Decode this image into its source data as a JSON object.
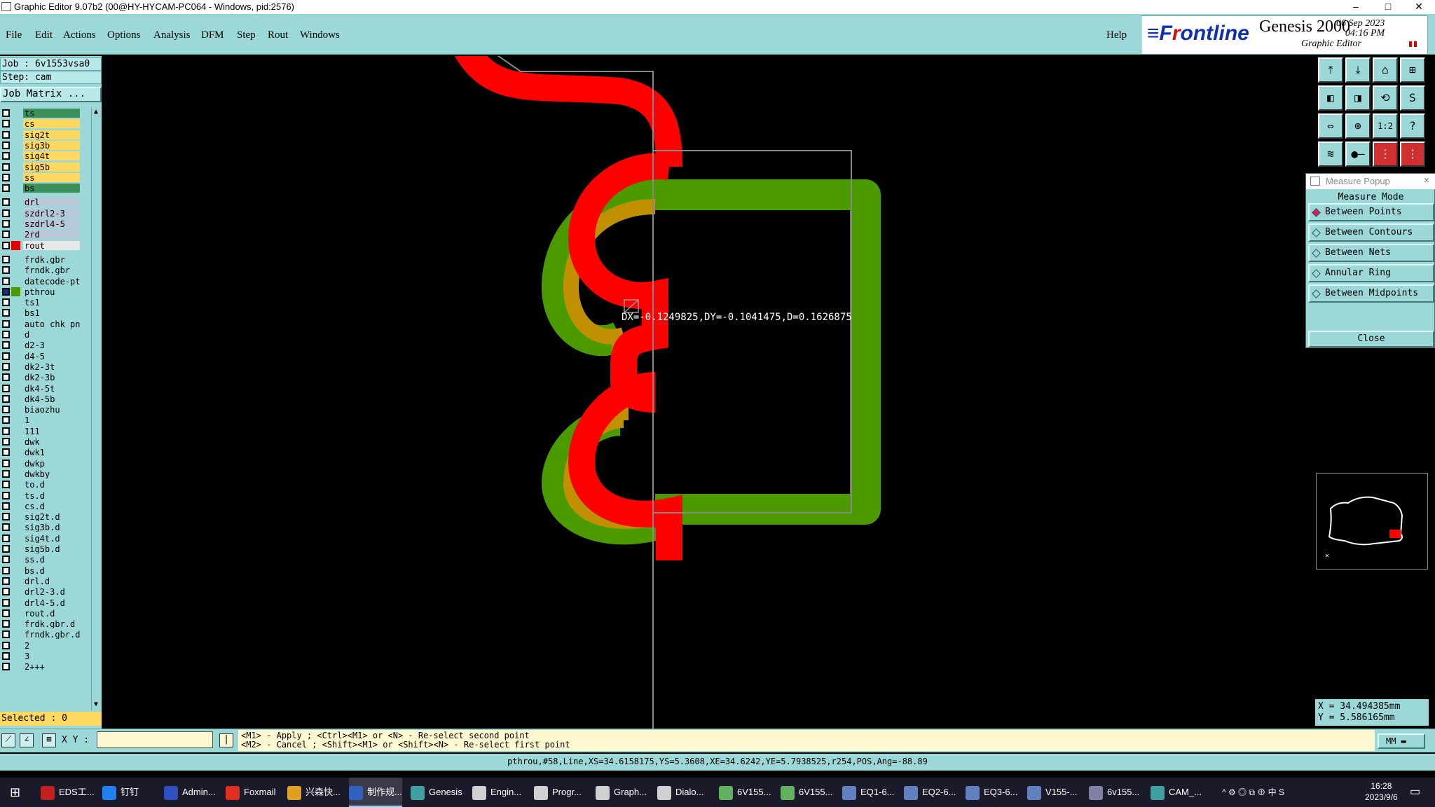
{
  "window": {
    "title": "Graphic Editor 9.07b2 (00@HY-HYCAM-PC064 - Windows, pid:2576)",
    "min": "–",
    "max": "□",
    "close": "✕"
  },
  "menu": {
    "file": "File",
    "edit": "Edit",
    "actions": "Actions",
    "options": "Options",
    "analysis": "Analysis",
    "dfm": "DFM",
    "step": "Step",
    "rout": "Rout",
    "windows": "Windows",
    "help": "Help"
  },
  "brand": {
    "logo_a": "≡F",
    "logo_b": "r",
    "logo_c": "ontline",
    "product": "Genesis 2000",
    "subtitle": "Graphic Editor",
    "date": "06 Sep 2023",
    "time": "04:16 PM"
  },
  "job": {
    "job_line": "Job : 6v1553vsa0",
    "step_line": "Step: cam",
    "matrix_button": "Job Matrix ..."
  },
  "layers": [
    {
      "name": "ts",
      "color": "#3a8f5a",
      "bg": "#3a8f5a"
    },
    {
      "name": "cs",
      "color": "#ffd860",
      "bg": "#ffd860"
    },
    {
      "name": "sig2t",
      "color": "#ffd860",
      "bg": "#ffd860"
    },
    {
      "name": "sig3b",
      "color": "#ffd860",
      "bg": "#ffd860"
    },
    {
      "name": "sig4t",
      "color": "#ffd860",
      "bg": "#ffd860"
    },
    {
      "name": "sig5b",
      "color": "#ffd860",
      "bg": "#ffd860"
    },
    {
      "name": "ss",
      "color": "#ffd860",
      "bg": "#ffd860"
    },
    {
      "name": "bs",
      "color": "#3a8f5a",
      "bg": "#3a8f5a"
    },
    {
      "name": "drl",
      "color": "#b8c8d8",
      "bg": "#b8c8d8"
    },
    {
      "name": "szdrl2-3",
      "color": "#b8c8d8",
      "bg": "#b8c8d8"
    },
    {
      "name": "szdrl4-5",
      "color": "#b8c8d8",
      "bg": "#b8c8d8"
    },
    {
      "name": "2rd",
      "color": "#b8c8d8",
      "bg": "#b8c8d8"
    },
    {
      "name": "rout",
      "color": "#e00000",
      "bg": "#e8e8e8"
    },
    {
      "name": "frdk.gbr",
      "color": "#9cd8d8",
      "bg": "#9cd8d8"
    },
    {
      "name": "frndk.gbr",
      "color": "#9cd8d8",
      "bg": "#9cd8d8"
    },
    {
      "name": "datecode-ptc",
      "color": "#9cd8d8",
      "bg": "#9cd8d8"
    },
    {
      "name": "pthrou",
      "color": "#4a9a00",
      "bg": "#9cd8d8"
    },
    {
      "name": "ts1",
      "color": "#9cd8d8",
      "bg": "#9cd8d8"
    },
    {
      "name": "bs1",
      "color": "#9cd8d8",
      "bg": "#9cd8d8"
    },
    {
      "name": "auto_chk_pn",
      "color": "#9cd8d8",
      "bg": "#9cd8d8"
    },
    {
      "name": "d",
      "color": "#9cd8d8",
      "bg": "#9cd8d8"
    },
    {
      "name": "d2-3",
      "color": "#9cd8d8",
      "bg": "#9cd8d8"
    },
    {
      "name": "d4-5",
      "color": "#9cd8d8",
      "bg": "#9cd8d8"
    },
    {
      "name": "dk2-3t",
      "color": "#9cd8d8",
      "bg": "#9cd8d8"
    },
    {
      "name": "dk2-3b",
      "color": "#9cd8d8",
      "bg": "#9cd8d8"
    },
    {
      "name": "dk4-5t",
      "color": "#9cd8d8",
      "bg": "#9cd8d8"
    },
    {
      "name": "dk4-5b",
      "color": "#9cd8d8",
      "bg": "#9cd8d8"
    },
    {
      "name": "biaozhu",
      "color": "#9cd8d8",
      "bg": "#9cd8d8"
    },
    {
      "name": "1",
      "color": "#9cd8d8",
      "bg": "#9cd8d8"
    },
    {
      "name": "111",
      "color": "#9cd8d8",
      "bg": "#9cd8d8"
    },
    {
      "name": "dwk",
      "color": "#9cd8d8",
      "bg": "#9cd8d8"
    },
    {
      "name": "dwk1",
      "color": "#9cd8d8",
      "bg": "#9cd8d8"
    },
    {
      "name": "dwkp",
      "color": "#9cd8d8",
      "bg": "#9cd8d8"
    },
    {
      "name": "dwkby",
      "color": "#9cd8d8",
      "bg": "#9cd8d8"
    },
    {
      "name": "to.d",
      "color": "#9cd8d8",
      "bg": "#9cd8d8"
    },
    {
      "name": "ts.d",
      "color": "#9cd8d8",
      "bg": "#9cd8d8"
    },
    {
      "name": "cs.d",
      "color": "#9cd8d8",
      "bg": "#9cd8d8"
    },
    {
      "name": "sig2t.d",
      "color": "#9cd8d8",
      "bg": "#9cd8d8"
    },
    {
      "name": "sig3b.d",
      "color": "#9cd8d8",
      "bg": "#9cd8d8"
    },
    {
      "name": "sig4t.d",
      "color": "#9cd8d8",
      "bg": "#9cd8d8"
    },
    {
      "name": "sig5b.d",
      "color": "#9cd8d8",
      "bg": "#9cd8d8"
    },
    {
      "name": "ss.d",
      "color": "#9cd8d8",
      "bg": "#9cd8d8"
    },
    {
      "name": "bs.d",
      "color": "#9cd8d8",
      "bg": "#9cd8d8"
    },
    {
      "name": "drl.d",
      "color": "#9cd8d8",
      "bg": "#9cd8d8"
    },
    {
      "name": "drl2-3.d",
      "color": "#9cd8d8",
      "bg": "#9cd8d8"
    },
    {
      "name": "drl4-5.d",
      "color": "#9cd8d8",
      "bg": "#9cd8d8"
    },
    {
      "name": "rout.d",
      "color": "#9cd8d8",
      "bg": "#9cd8d8"
    },
    {
      "name": "frdk.gbr.d",
      "color": "#9cd8d8",
      "bg": "#9cd8d8"
    },
    {
      "name": "frndk.gbr.d",
      "color": "#9cd8d8",
      "bg": "#9cd8d8"
    },
    {
      "name": "2",
      "color": "#9cd8d8",
      "bg": "#9cd8d8"
    },
    {
      "name": "3",
      "color": "#9cd8d8",
      "bg": "#9cd8d8"
    },
    {
      "name": "2+++",
      "color": "#9cd8d8",
      "bg": "#9cd8d8"
    }
  ],
  "selected": "Selected : 0",
  "measurement": "DX=-0.1249825,DY=-0.1041475,D=0.1626875",
  "measure_popup": {
    "title": "Measure Popup",
    "mode_label": "Measure Mode",
    "options": [
      "Between Points",
      "Between Contours",
      "Between Nets",
      "Annular Ring",
      "Between Midpoints"
    ],
    "active_index": 0,
    "close": "Close"
  },
  "coords": {
    "x": "X = 34.494385mm",
    "y": "Y = 5.586165mm",
    "units": "MM"
  },
  "cmd": {
    "xy_label": "X Y :",
    "xy_value": "",
    "help1": "<M1> - Apply ; <Ctrl><M1> or <N> - Re-select second point",
    "help2": "<M2> - Cancel ; <Shift><M1> or <Shift><N> - Re-select first point"
  },
  "status": "pthrou,#58,Line,XS=34.6158175,YS=5.3608,XE=34.6242,YE=5.7938525,r254,POS,Ang=-88.89",
  "colors": {
    "panel": "#9cd8d8",
    "red": "#ff0000",
    "green": "#4a9a00",
    "overlap": "#c09000"
  },
  "taskbar": [
    {
      "label": "EDS工...",
      "color": "#c02020"
    },
    {
      "label": "钉钉",
      "color": "#2080f0"
    },
    {
      "label": "Admin...",
      "color": "#3050c0"
    },
    {
      "label": "Foxmail",
      "color": "#e03020"
    },
    {
      "label": "兴森快...",
      "color": "#e0a020"
    },
    {
      "label": "制作规...",
      "color": "#3060c0"
    },
    {
      "label": "Genesis",
      "color": "#40a0a0"
    },
    {
      "label": "Engin...",
      "color": "#d0d0d0"
    },
    {
      "label": "Progr...",
      "color": "#d0d0d0"
    },
    {
      "label": "Graph...",
      "color": "#d0d0d0"
    },
    {
      "label": "Dialo...",
      "color": "#d0d0d0"
    },
    {
      "label": "6V155...",
      "color": "#60b060"
    },
    {
      "label": "6V155...",
      "color": "#60b060"
    },
    {
      "label": "EQ1-6...",
      "color": "#6080c0"
    },
    {
      "label": "EQ2-6...",
      "color": "#6080c0"
    },
    {
      "label": "EQ3-6...",
      "color": "#6080c0"
    },
    {
      "label": "V155-...",
      "color": "#6080c0"
    },
    {
      "label": "6v155...",
      "color": "#8080a0"
    },
    {
      "label": "CAM_...",
      "color": "#40a0a0"
    }
  ],
  "clock": {
    "time": "16:28",
    "date": "2023/9/6"
  },
  "tray": "^ ⚙ ◎ ⧉ ⊕ 中 S"
}
